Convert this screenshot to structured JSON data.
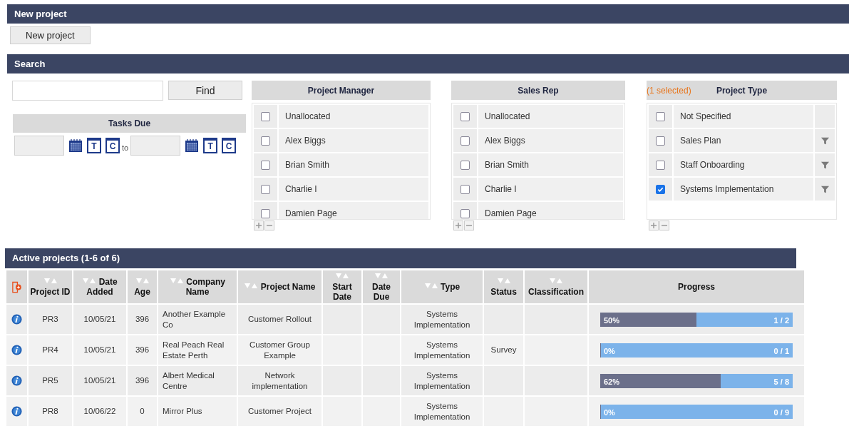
{
  "new_project": {
    "title": "New project",
    "button": "New project"
  },
  "search": {
    "title": "Search",
    "find_button": "Find",
    "tasks_due": {
      "title": "Tasks Due",
      "to_label": "to",
      "from_buttons": [
        {
          "kind": "calendar"
        },
        {
          "kind": "letter",
          "label": "T"
        },
        {
          "kind": "letter",
          "label": "C"
        }
      ],
      "to_buttons": [
        {
          "kind": "calendar"
        },
        {
          "kind": "letter",
          "label": "T"
        },
        {
          "kind": "letter",
          "label": "C"
        }
      ]
    },
    "filters": [
      {
        "title": "Project Manager",
        "items": [
          {
            "label": "Unallocated",
            "checked": false
          },
          {
            "label": "Alex Biggs",
            "checked": false
          },
          {
            "label": "Brian Smith",
            "checked": false
          },
          {
            "label": "Charlie I",
            "checked": false
          },
          {
            "label": "Damien Page",
            "checked": false
          }
        ]
      },
      {
        "title": "Sales Rep",
        "items": [
          {
            "label": "Unallocated",
            "checked": false
          },
          {
            "label": "Alex Biggs",
            "checked": false
          },
          {
            "label": "Brian Smith",
            "checked": false
          },
          {
            "label": "Charlie I",
            "checked": false
          },
          {
            "label": "Damien Page",
            "checked": false
          }
        ]
      },
      {
        "title": "Project Type",
        "selected_count": "(1 selected)",
        "items": [
          {
            "label": "Not Specified",
            "checked": false,
            "filter": false
          },
          {
            "label": "Sales Plan",
            "checked": false,
            "filter": true
          },
          {
            "label": "Staff Onboarding",
            "checked": false,
            "filter": true
          },
          {
            "label": "Systems Implementation",
            "checked": true,
            "filter": true
          }
        ]
      }
    ]
  },
  "projects": {
    "title": "Active projects (1-6 of 6)",
    "columns": [
      {
        "kind": "icon"
      },
      {
        "kind": "text",
        "label": "Project ID",
        "sortable": true
      },
      {
        "kind": "text",
        "label": "Date Added",
        "sortable": true
      },
      {
        "kind": "text",
        "label": "Age",
        "sortable": true
      },
      {
        "kind": "text",
        "label": "Company Name",
        "sortable": true
      },
      {
        "kind": "text",
        "label": "Project Name",
        "sortable": true
      },
      {
        "kind": "text",
        "label": "Start Date",
        "sortable": true
      },
      {
        "kind": "text",
        "label": "Date Due",
        "sortable": true
      },
      {
        "kind": "text",
        "label": "Type",
        "sortable": true
      },
      {
        "kind": "text",
        "label": "Status",
        "sortable": true
      },
      {
        "kind": "text",
        "label": "Classification",
        "sortable": true
      },
      {
        "kind": "text",
        "label": "Progress",
        "sortable": false
      }
    ],
    "rows": [
      {
        "id": "PR3",
        "date_added": "10/05/21",
        "age": "396",
        "company": "Another Example Co",
        "project_name": "Customer Rollout",
        "type": "Systems Implementation",
        "progress": {
          "level": 0.5,
          "percent": "50%",
          "count": "1 / 2"
        }
      },
      {
        "id": "PR4",
        "date_added": "10/05/21",
        "age": "396",
        "company": "Real Peach Real Estate Perth",
        "project_name": "Customer Group Example",
        "type": "Systems Implementation",
        "status": "Survey",
        "progress": {
          "level": 0,
          "percent": "0%",
          "count": "0 / 1"
        }
      },
      {
        "id": "PR5",
        "date_added": "10/05/21",
        "age": "396",
        "company": "Albert Medical Centre",
        "project_name": "Network implementation",
        "type": "Systems Implementation",
        "progress": {
          "level": 0.625,
          "percent": "62%",
          "count": "5 / 8"
        }
      },
      {
        "id": "PR8",
        "date_added": "10/06/22",
        "age": "0",
        "company": "Mirror Plus",
        "project_name": "Customer Project",
        "type": "Systems Implementation",
        "progress": {
          "level": 0,
          "percent": "0%",
          "count": "0 / 9"
        }
      }
    ]
  }
}
